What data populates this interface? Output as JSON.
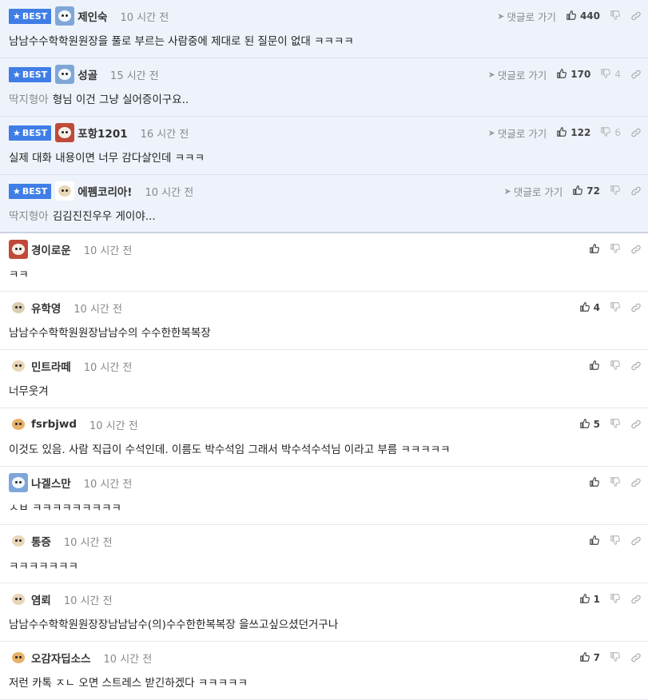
{
  "labels": {
    "best": "BEST",
    "reply": "댓글로 가기"
  },
  "colors": {
    "best_badge": "#3f7ee6",
    "best_background": "#eef3fb"
  },
  "comments": [
    {
      "best": true,
      "avatar": "blue-dog-avatar",
      "nickname": "제인숙",
      "time": "10 시간 전",
      "likes": "440",
      "dislikes": "",
      "mention": "",
      "text": "남남수수학학원원장을 풀로 부르는 사람중에 제대로 된 질문이 없대 ㅋㅋㅋㅋ"
    },
    {
      "best": true,
      "avatar": "blue-dog-avatar",
      "nickname": "성골",
      "time": "15 시간 전",
      "likes": "170",
      "dislikes": "4",
      "mention": "딱지형아",
      "text": "형님 이건 그냥 실어증이구요.."
    },
    {
      "best": true,
      "avatar": "red-dog-avatar",
      "nickname": "포항1201",
      "time": "16 시간 전",
      "likes": "122",
      "dislikes": "6",
      "mention": "",
      "text": "실제 대화 내용이면 너무 감다살인데 ㅋㅋㅋ"
    },
    {
      "best": true,
      "avatar": "puppy-avatar",
      "nickname": "에펨코리아!",
      "time": "10 시간 전",
      "likes": "72",
      "dislikes": "",
      "mention": "딱지형아",
      "text": "김김진진우우 게이야..."
    },
    {
      "best": false,
      "avatar": "red-dog-avatar",
      "nickname": "경이로운",
      "time": "10 시간 전",
      "likes": "",
      "dislikes": "",
      "mention": "",
      "text": "ㅋㅋ"
    },
    {
      "best": false,
      "avatar": "egg-avatar",
      "nickname": "유학영",
      "time": "10 시간 전",
      "likes": "4",
      "dislikes": "",
      "mention": "",
      "text": "남남수수학학원원장남남수의 수수한한복복장"
    },
    {
      "best": false,
      "avatar": "puppy-avatar",
      "nickname": "민트라떼",
      "time": "10 시간 전",
      "likes": "",
      "dislikes": "",
      "mention": "",
      "text": "너무웃겨"
    },
    {
      "best": false,
      "avatar": "fox-avatar",
      "nickname": "fsrbjwd",
      "time": "10 시간 전",
      "likes": "5",
      "dislikes": "",
      "mention": "",
      "text": "이것도 있음. 사람 직급이 수석인데. 이름도 박수석임 그래서 박수석수석님 이라고 부름 ㅋㅋㅋㅋㅋ"
    },
    {
      "best": false,
      "avatar": "blue-dog-avatar",
      "nickname": "나겔스만",
      "time": "10 시간 전",
      "likes": "",
      "dislikes": "",
      "mention": "",
      "text": "ㅅㅂ ㅋㅋㅋㅋㅋㅋㅋㅋㅋ"
    },
    {
      "best": false,
      "avatar": "puppy-avatar",
      "nickname": "통증",
      "time": "10 시간 전",
      "likes": "",
      "dislikes": "",
      "mention": "",
      "text": "ㅋㅋㅋㅋㅋㅋㅋ"
    },
    {
      "best": false,
      "avatar": "puppy-avatar",
      "nickname": "염뢰",
      "time": "10 시간 전",
      "likes": "1",
      "dislikes": "",
      "mention": "",
      "text": "남남수수학학원원장장남남남수(의)수수한한복복장 을쓰고싶으셨던거구나"
    },
    {
      "best": false,
      "avatar": "fox-avatar",
      "nickname": "오감자딥소스",
      "time": "10 시간 전",
      "likes": "7",
      "dislikes": "",
      "mention": "",
      "text": "저런 카톡 ㅈㄴ 오면 스트레스 받긴하겠다 ㅋㅋㅋㅋㅋ"
    }
  ]
}
